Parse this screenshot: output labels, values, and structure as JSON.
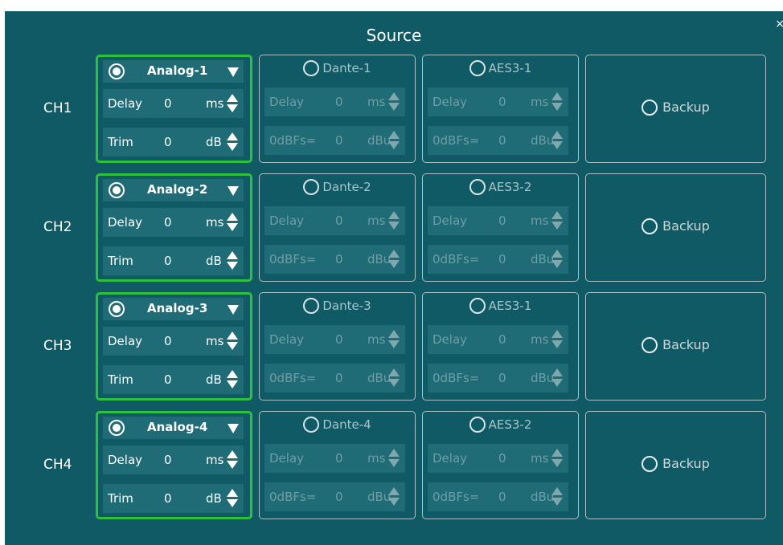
{
  "dialog": {
    "title": "Source",
    "close_glyph": "×"
  },
  "colors": {
    "background": "#105a66",
    "active_border": "#2ec23c",
    "field_bg": "#1f6b76"
  },
  "channels": [
    {
      "label": "CH1",
      "analog": "Analog-1",
      "delay": "0",
      "delay_unit": "ms",
      "trim_label": "Trim",
      "trim": "0",
      "trim_unit": "dB",
      "dante": "Dante-1",
      "aes": "AES3-1"
    },
    {
      "label": "CH2",
      "analog": "Analog-2",
      "delay": "0",
      "delay_unit": "ms",
      "trim_label": "Trim",
      "trim": "0",
      "trim_unit": "dB",
      "dante": "Dante-2",
      "aes": "AES3-2"
    },
    {
      "label": "CH3",
      "analog": "Analog-3",
      "delay": "0",
      "delay_unit": "ms",
      "trim_label": "Trim",
      "trim": "0",
      "trim_unit": "dB",
      "dante": "Dante-3",
      "aes": "AES3-1"
    },
    {
      "label": "CH4",
      "analog": "Analog-4",
      "delay": "0",
      "delay_unit": "ms",
      "trim_label": "Trim",
      "trim": "0",
      "trim_unit": "dB",
      "dante": "Dante-4",
      "aes": "AES3-2"
    }
  ],
  "labels": {
    "delay": "Delay",
    "delay_value": "0",
    "delay_unit": "ms",
    "ref": "0dBFs=",
    "ref_value": "0",
    "ref_unit": "dBu",
    "backup": "Backup"
  },
  "icons": {
    "radio": "radio-icon",
    "dropdown": "dropdown-arrow-icon",
    "spinner": "spinner-icon"
  }
}
